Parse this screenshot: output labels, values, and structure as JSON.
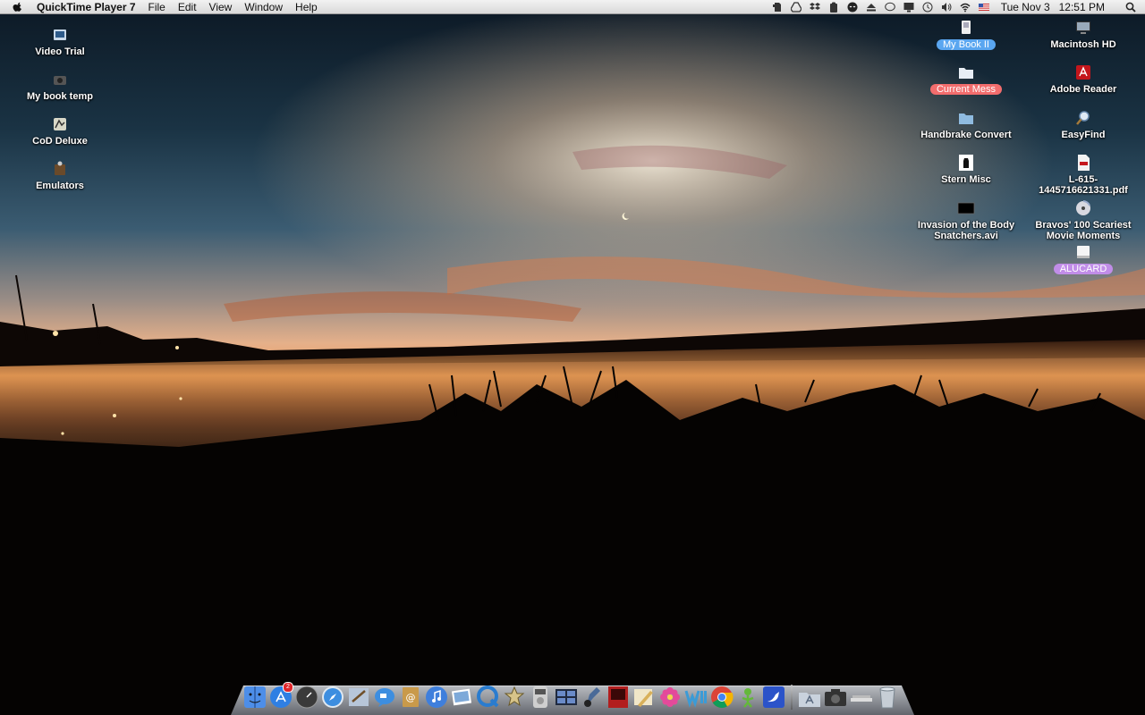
{
  "menubar": {
    "app_name": "QuickTime Player 7",
    "menus": [
      "File",
      "Edit",
      "View",
      "Window",
      "Help"
    ],
    "status_icons": [
      "evernote-icon",
      "google-drive-icon",
      "dropbox-icon",
      "clipboard-icon",
      "alien-icon",
      "eject-icon",
      "speech-bubble-icon",
      "display-icon",
      "time-machine-icon",
      "volume-icon",
      "wifi-icon",
      "us-flag-icon"
    ],
    "date": "Tue Nov 3",
    "time": "12:51 PM"
  },
  "desktop": {
    "left_icons": [
      {
        "label": "Video Trial",
        "icon": "video-file-icon"
      },
      {
        "label": "My book temp",
        "icon": "camera-icon"
      },
      {
        "label": "CoD Deluxe",
        "icon": "game-app-icon"
      },
      {
        "label": "Emulators",
        "icon": "emulator-app-icon"
      }
    ],
    "right_icons": [
      {
        "label": "My Book II",
        "icon": "external-drive-icon",
        "tag_color": "#5aa6f0"
      },
      {
        "label": "Macintosh HD",
        "icon": "hard-drive-icon"
      },
      {
        "label": "Current Mess",
        "icon": "folder-icon",
        "tag_color": "#f36d6d"
      },
      {
        "label": "Adobe Reader",
        "icon": "adobe-reader-icon"
      },
      {
        "label": "Handbrake Convert",
        "icon": "folder-icon"
      },
      {
        "label": "EasyFind",
        "icon": "magnifier-icon"
      },
      {
        "label": "Stern Misc",
        "icon": "fist-icon"
      },
      {
        "label": "L-615-1445716621331.pdf",
        "icon": "pdf-file-icon"
      },
      {
        "label": "Invasion of the Body Snatchers.avi",
        "icon": "video-thumbnail-icon"
      },
      {
        "label": "Bravos' 100 Scariest Movie Moments",
        "icon": "dvd-disc-icon"
      },
      {
        "label": "ALUCARD",
        "icon": "usb-drive-icon",
        "tag_color": "#c18de8"
      }
    ]
  },
  "dock": {
    "apps": [
      {
        "name": "finder-icon",
        "color": "#4d8ee8"
      },
      {
        "name": "app-store-icon",
        "color": "#2f7fe3",
        "badge": "2"
      },
      {
        "name": "dashboard-icon",
        "color": "#3a3a3a"
      },
      {
        "name": "safari-icon",
        "color": "#3d8ee0"
      },
      {
        "name": "mail-icon",
        "color": "#6f9bd3"
      },
      {
        "name": "ichat-icon",
        "color": "#3d8ee0"
      },
      {
        "name": "address-book-icon",
        "color": "#c99a4a"
      },
      {
        "name": "itunes-icon",
        "color": "#3f7fdc"
      },
      {
        "name": "iphoto-icon",
        "color": "#7da9d9"
      },
      {
        "name": "quicktime-icon",
        "color": "#2a7ccf"
      },
      {
        "name": "imovie-icon",
        "color": "#9a7a2a"
      },
      {
        "name": "dvd-player-icon",
        "color": "#b8b8b8"
      },
      {
        "name": "spaces-icon",
        "color": "#4e6fa8"
      },
      {
        "name": "garageband-icon",
        "color": "#6a8bb8"
      },
      {
        "name": "photo-booth-icon",
        "color": "#b21e1e"
      },
      {
        "name": "pencil-app-icon",
        "color": "#d8b05a"
      },
      {
        "name": "flower-app-icon",
        "color": "#e44a9a"
      },
      {
        "name": "word-app-icon",
        "color": "#3b9bd6"
      },
      {
        "name": "chrome-icon",
        "color": "#3ea84a"
      },
      {
        "name": "xbox-app-icon",
        "color": "#64b83a"
      },
      {
        "name": "bird-app-icon",
        "color": "#2b53c9"
      }
    ],
    "extras": [
      {
        "name": "applications-folder-icon",
        "color": "#a9b6c6"
      },
      {
        "name": "camera-folder-icon",
        "color": "#333"
      },
      {
        "name": "documents-stack-icon",
        "color": "#ddd"
      },
      {
        "name": "trash-icon",
        "color": "#9aa"
      }
    ]
  }
}
